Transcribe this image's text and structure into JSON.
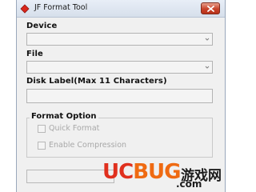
{
  "window": {
    "title": "JF Format Tool"
  },
  "form": {
    "device_label": "Device",
    "device_value": "",
    "file_label": "File",
    "file_value": "",
    "disk_label_label": "Disk Label(Max 11 Characters)",
    "disk_label_value": ""
  },
  "format_option": {
    "legend": "Format Option",
    "options": [
      {
        "label": "Quick Format",
        "checked": false,
        "enabled": false
      },
      {
        "label": "Enable Compression",
        "checked": false,
        "enabled": false
      }
    ]
  },
  "progress": {
    "value": 0
  },
  "watermark": {
    "brand_uc": "UC",
    "brand_bug": "BUG",
    "game": "游戏网",
    "domain": ".com"
  },
  "colors": {
    "close_button": "#c8432b",
    "watermark_red": "#e0301e",
    "watermark_orange": "#ef6a12",
    "disabled_text": "#a8a8a8"
  },
  "icons": {
    "app": "red-diamond-icon",
    "close": "close-icon",
    "combo_arrow": "chevron-down-icon"
  }
}
